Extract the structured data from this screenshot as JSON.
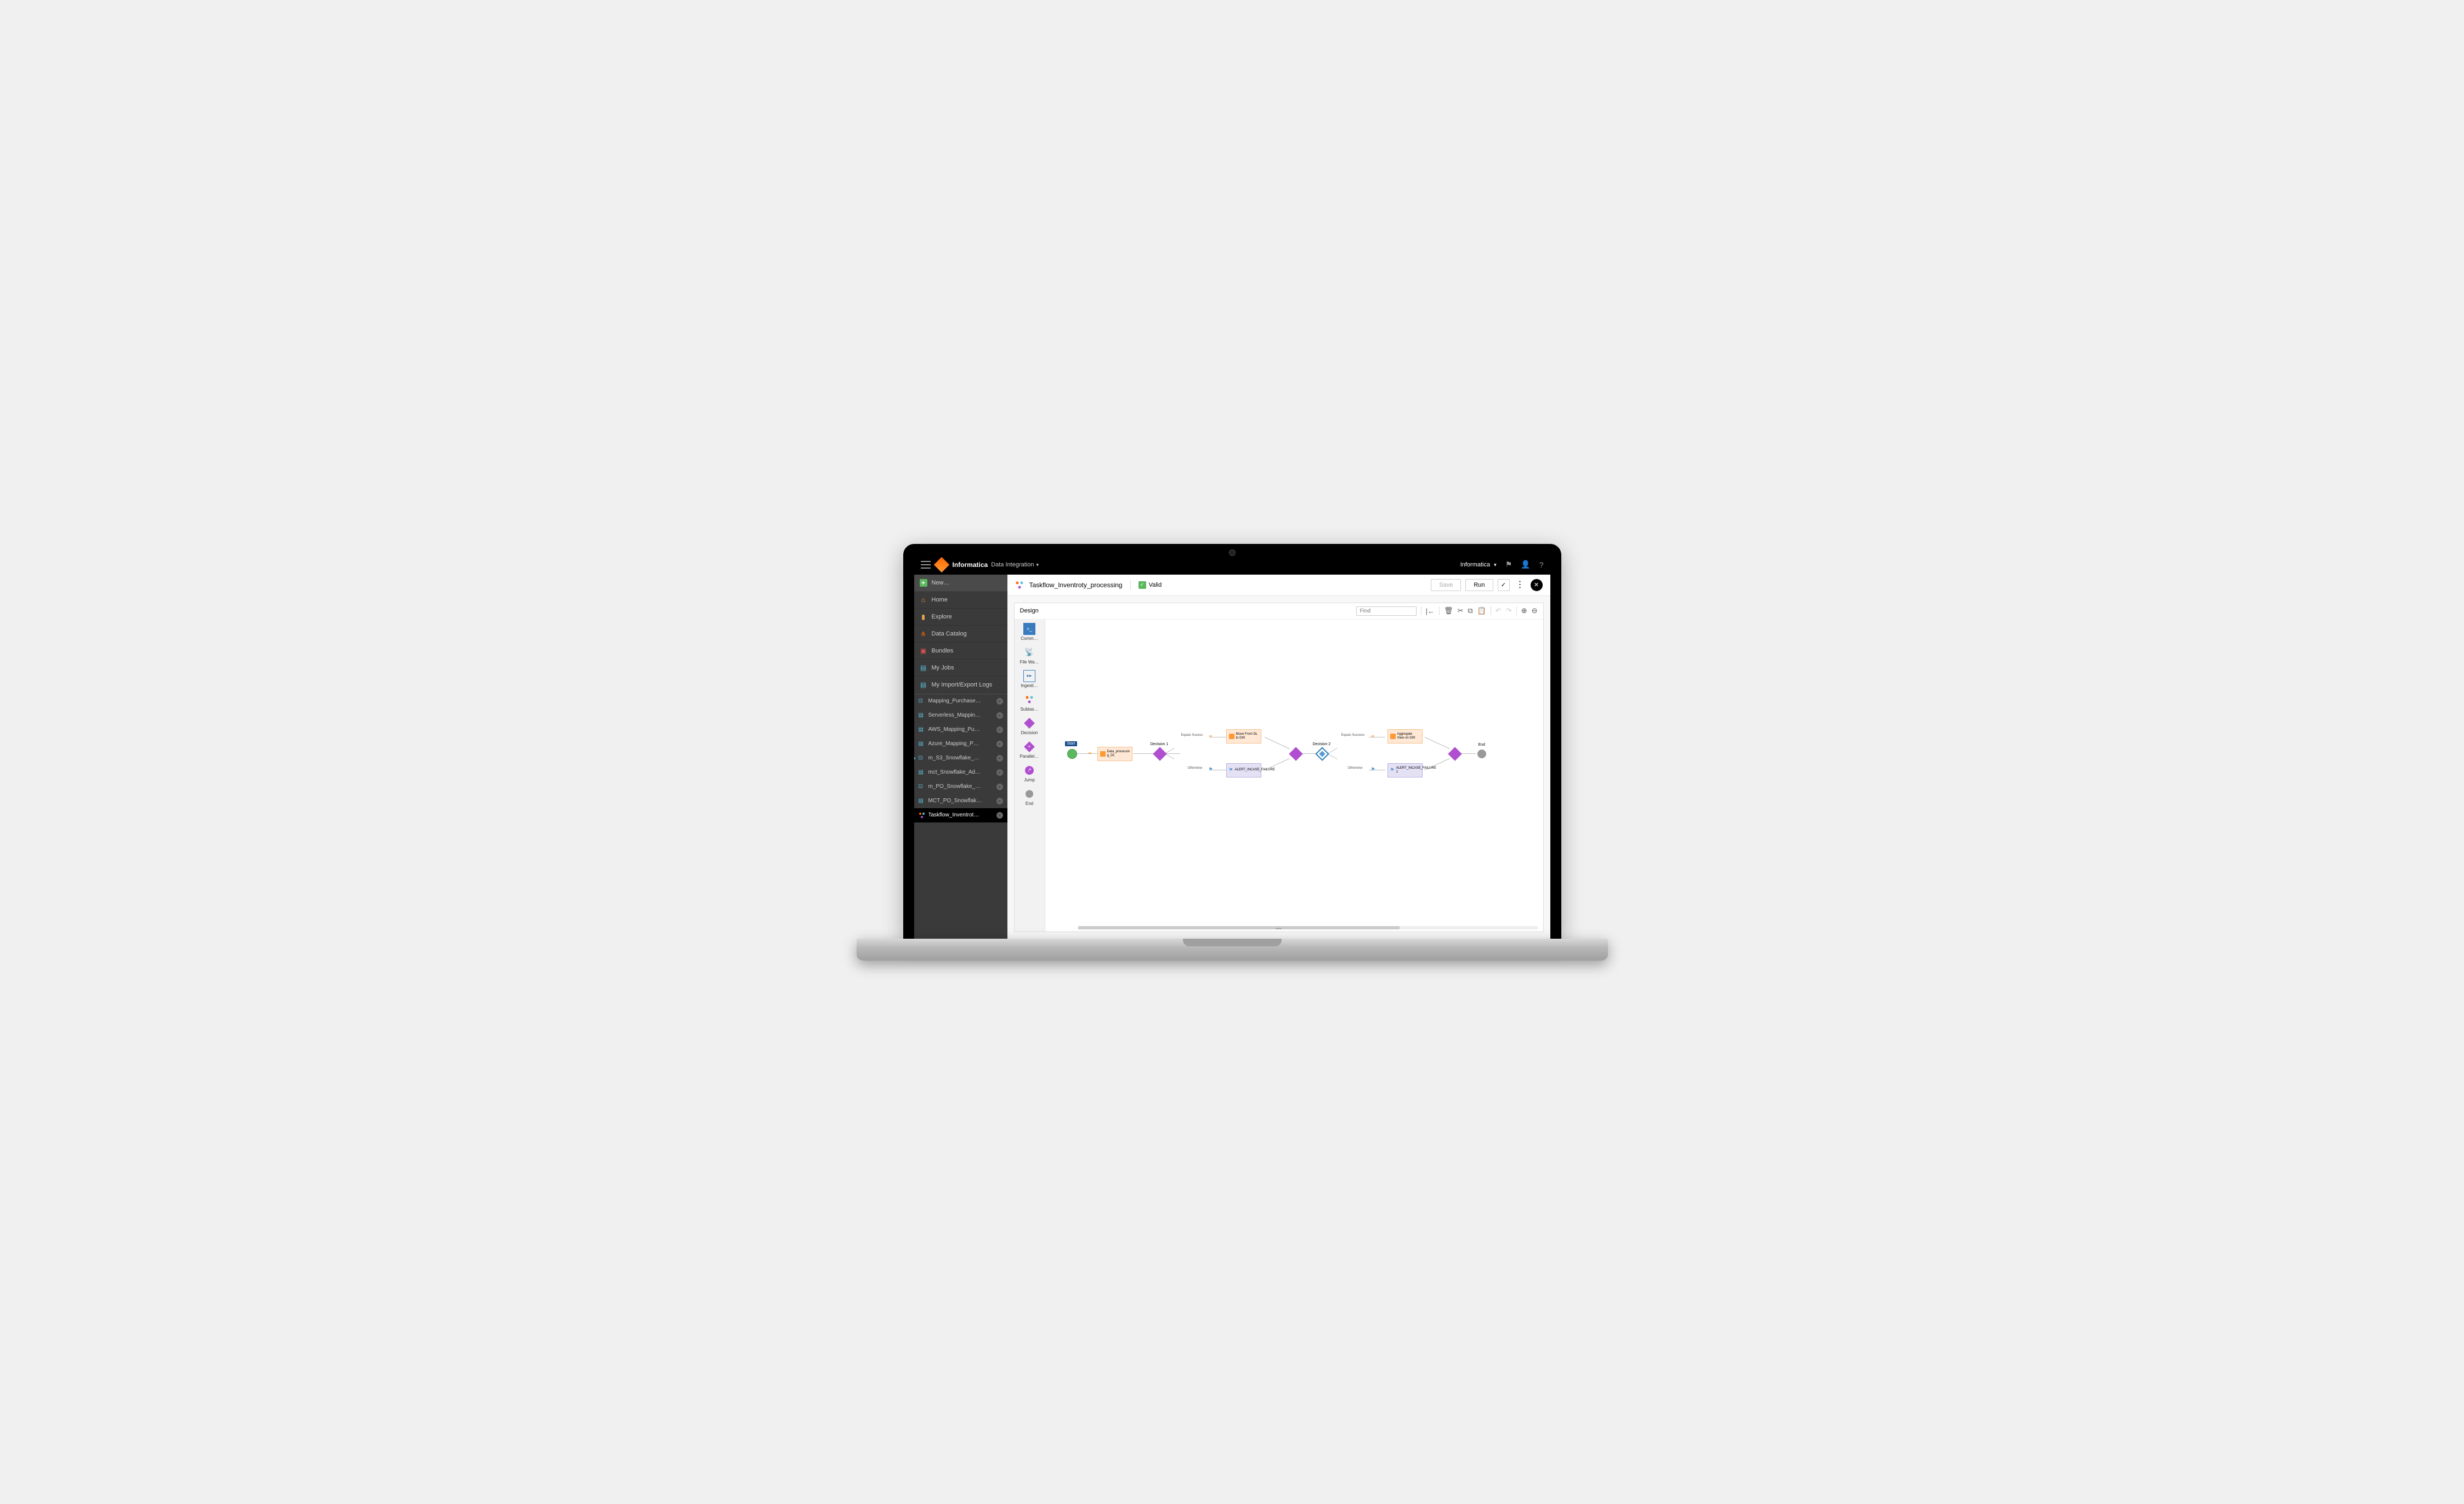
{
  "topbar": {
    "brand": "Informatica",
    "product": "Data Integration",
    "org_label": "Informatica"
  },
  "sidebar": {
    "new_label": "New…",
    "nav": [
      {
        "label": "Home",
        "icon": "home"
      },
      {
        "label": "Explore",
        "icon": "folder"
      },
      {
        "label": "Data Catalog",
        "icon": "catalog"
      },
      {
        "label": "Bundles",
        "icon": "bundles"
      },
      {
        "label": "My Jobs",
        "icon": "jobs"
      },
      {
        "label": "My Import/Export Logs",
        "icon": "logs"
      }
    ],
    "tabs": [
      {
        "label": "Mapping_Purchase…",
        "type": "mapping"
      },
      {
        "label": "Serverless_Mappin…",
        "type": "worksheet"
      },
      {
        "label": "AWS_Mapping_Pu…",
        "type": "worksheet"
      },
      {
        "label": "Azure_Mapping_P…",
        "type": "worksheet"
      },
      {
        "label": "m_S3_Snowflake_…",
        "type": "mapping",
        "modified": true
      },
      {
        "label": "mct_Snowflake_Ad…",
        "type": "worksheet"
      },
      {
        "label": "m_PO_Snowflake_…",
        "type": "mapping"
      },
      {
        "label": "MCT_PO_Snowflak…",
        "type": "worksheet"
      },
      {
        "label": "Taskflow_Inventrot…",
        "type": "taskflow",
        "active": true
      }
    ]
  },
  "designer": {
    "title": "Taskflow_Inventroty_processing",
    "status": "Valid",
    "save_btn": "Save",
    "run_btn": "Run",
    "section_label": "Design",
    "find_placeholder": "Find"
  },
  "palette": [
    {
      "label": "Comm…"
    },
    {
      "label": "File Wa…"
    },
    {
      "label": "Ingesti…"
    },
    {
      "label": "Subtas…"
    },
    {
      "label": "Decision"
    },
    {
      "label": "Parallel…"
    },
    {
      "label": "Jump"
    },
    {
      "label": "End"
    }
  ],
  "flow": {
    "start": "Start",
    "task1": "Data_processin g_DL",
    "decision1": "Decision 1",
    "branch1_success": "Equals Sucess",
    "branch1_otherwise": "Otherwise",
    "task2": "Move From DL to DW",
    "alert1": "ALERT_INCASE_FAILURE",
    "decision2": "Decision 2",
    "branch2_success": "Equals Success",
    "branch2_otherwise": "Otherwise",
    "task3": "Aggregate View on DW",
    "alert2": "ALERT_INCASE_FAILURE 1",
    "end": "End"
  }
}
